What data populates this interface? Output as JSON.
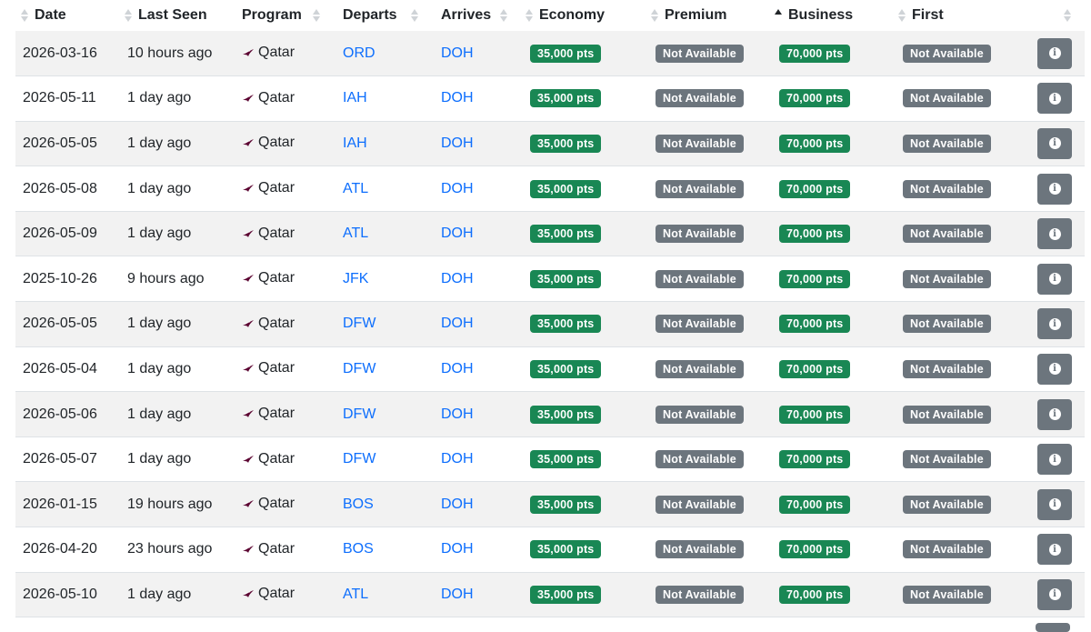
{
  "columns": [
    {
      "label": "Date",
      "sort": "none"
    },
    {
      "label": "Last Seen",
      "sort": "none"
    },
    {
      "label": "Program",
      "sort": "none"
    },
    {
      "label": "Departs",
      "sort": "none"
    },
    {
      "label": "Arrives",
      "sort": "none"
    },
    {
      "label": "Economy",
      "sort": "none"
    },
    {
      "label": "Premium",
      "sort": "none"
    },
    {
      "label": "Business",
      "sort": "asc"
    },
    {
      "label": "First",
      "sort": "none"
    }
  ],
  "colors": {
    "available": "#198754",
    "not_available": "#6c757d",
    "link": "#0d6efd",
    "stripe": "#f2f2f2"
  },
  "rows": [
    {
      "date": "2026-03-16",
      "last_seen": "10 hours ago",
      "program": "Qatar",
      "departs": "ORD",
      "arrives": "DOH",
      "economy": "35,000 pts",
      "premium": "Not Available",
      "business": "70,000 pts",
      "first": "Not Available"
    },
    {
      "date": "2026-05-11",
      "last_seen": "1 day ago",
      "program": "Qatar",
      "departs": "IAH",
      "arrives": "DOH",
      "economy": "35,000 pts",
      "premium": "Not Available",
      "business": "70,000 pts",
      "first": "Not Available"
    },
    {
      "date": "2026-05-05",
      "last_seen": "1 day ago",
      "program": "Qatar",
      "departs": "IAH",
      "arrives": "DOH",
      "economy": "35,000 pts",
      "premium": "Not Available",
      "business": "70,000 pts",
      "first": "Not Available"
    },
    {
      "date": "2026-05-08",
      "last_seen": "1 day ago",
      "program": "Qatar",
      "departs": "ATL",
      "arrives": "DOH",
      "economy": "35,000 pts",
      "premium": "Not Available",
      "business": "70,000 pts",
      "first": "Not Available"
    },
    {
      "date": "2026-05-09",
      "last_seen": "1 day ago",
      "program": "Qatar",
      "departs": "ATL",
      "arrives": "DOH",
      "economy": "35,000 pts",
      "premium": "Not Available",
      "business": "70,000 pts",
      "first": "Not Available"
    },
    {
      "date": "2025-10-26",
      "last_seen": "9 hours ago",
      "program": "Qatar",
      "departs": "JFK",
      "arrives": "DOH",
      "economy": "35,000 pts",
      "premium": "Not Available",
      "business": "70,000 pts",
      "first": "Not Available"
    },
    {
      "date": "2026-05-05",
      "last_seen": "1 day ago",
      "program": "Qatar",
      "departs": "DFW",
      "arrives": "DOH",
      "economy": "35,000 pts",
      "premium": "Not Available",
      "business": "70,000 pts",
      "first": "Not Available"
    },
    {
      "date": "2026-05-04",
      "last_seen": "1 day ago",
      "program": "Qatar",
      "departs": "DFW",
      "arrives": "DOH",
      "economy": "35,000 pts",
      "premium": "Not Available",
      "business": "70,000 pts",
      "first": "Not Available"
    },
    {
      "date": "2026-05-06",
      "last_seen": "1 day ago",
      "program": "Qatar",
      "departs": "DFW",
      "arrives": "DOH",
      "economy": "35,000 pts",
      "premium": "Not Available",
      "business": "70,000 pts",
      "first": "Not Available"
    },
    {
      "date": "2026-05-07",
      "last_seen": "1 day ago",
      "program": "Qatar",
      "departs": "DFW",
      "arrives": "DOH",
      "economy": "35,000 pts",
      "premium": "Not Available",
      "business": "70,000 pts",
      "first": "Not Available"
    },
    {
      "date": "2026-01-15",
      "last_seen": "19 hours ago",
      "program": "Qatar",
      "departs": "BOS",
      "arrives": "DOH",
      "economy": "35,000 pts",
      "premium": "Not Available",
      "business": "70,000 pts",
      "first": "Not Available"
    },
    {
      "date": "2026-04-20",
      "last_seen": "23 hours ago",
      "program": "Qatar",
      "departs": "BOS",
      "arrives": "DOH",
      "economy": "35,000 pts",
      "premium": "Not Available",
      "business": "70,000 pts",
      "first": "Not Available"
    },
    {
      "date": "2026-05-10",
      "last_seen": "1 day ago",
      "program": "Qatar",
      "departs": "ATL",
      "arrives": "DOH",
      "economy": "35,000 pts",
      "premium": "Not Available",
      "business": "70,000 pts",
      "first": "Not Available"
    }
  ]
}
